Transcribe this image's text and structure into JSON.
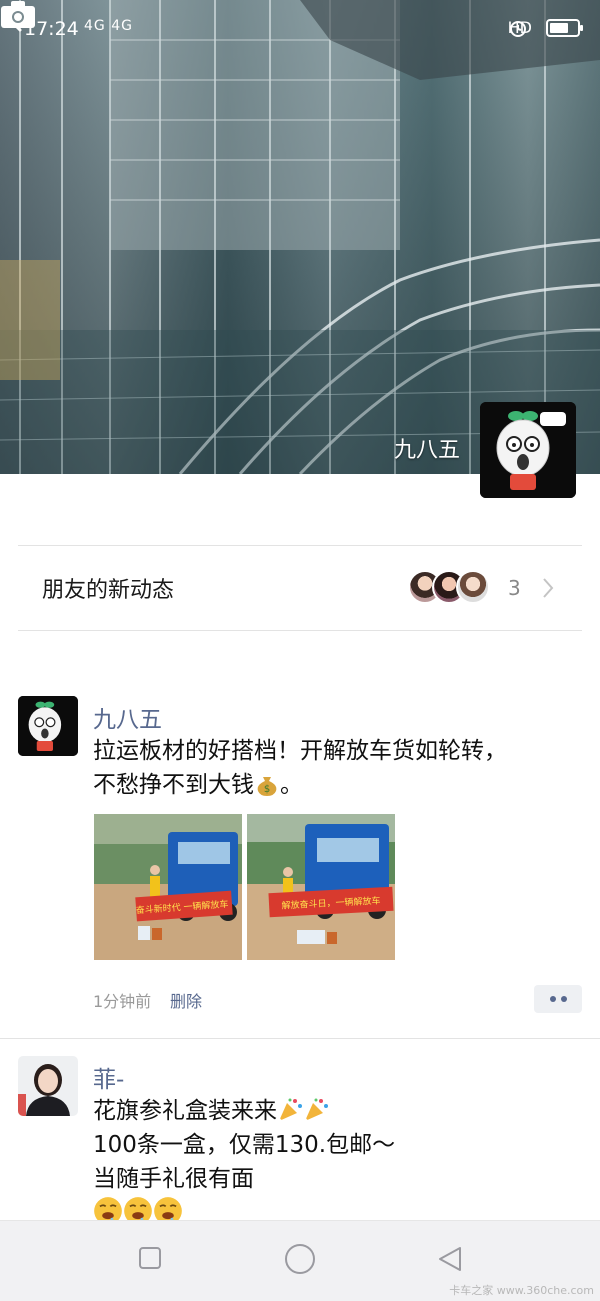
{
  "status_bar": {
    "time": "17:24",
    "signal_text": "4G 4G",
    "network": "HD"
  },
  "cover": {
    "name": "九八五"
  },
  "friend_updates": {
    "title": "朋友的新动态",
    "count": "3"
  },
  "posts": [
    {
      "author": "九八五",
      "text_lines": [
        "拉运板材的好搭档！开解放车货如轮转，",
        "不愁挣不到大钱"
      ],
      "text_tail": "。",
      "time": "1分钟前",
      "delete_label": "删除",
      "photos": [
        {
          "banner": "奋斗新时代 一辆解放车"
        },
        {
          "banner": "解放奋斗日，一辆解放车"
        }
      ]
    },
    {
      "author": "菲-",
      "text_lines": [
        "花旗参礼盒装来来",
        "100条一盒，仅需130.包邮～",
        "当随手礼很有面"
      ]
    }
  ],
  "watermark": "卡车之家 www.360che.com",
  "colors": {
    "link": "#57688e",
    "nav_bar": "#f1f1f3",
    "divider": "#e3e3e3"
  },
  "icons": [
    "back-arrow-icon",
    "camera-icon",
    "chevron-right-icon",
    "money-bag-emoji",
    "party-popper-emoji",
    "drooling-face-emoji",
    "square-nav-icon",
    "circle-nav-icon",
    "triangle-back-nav-icon"
  ]
}
